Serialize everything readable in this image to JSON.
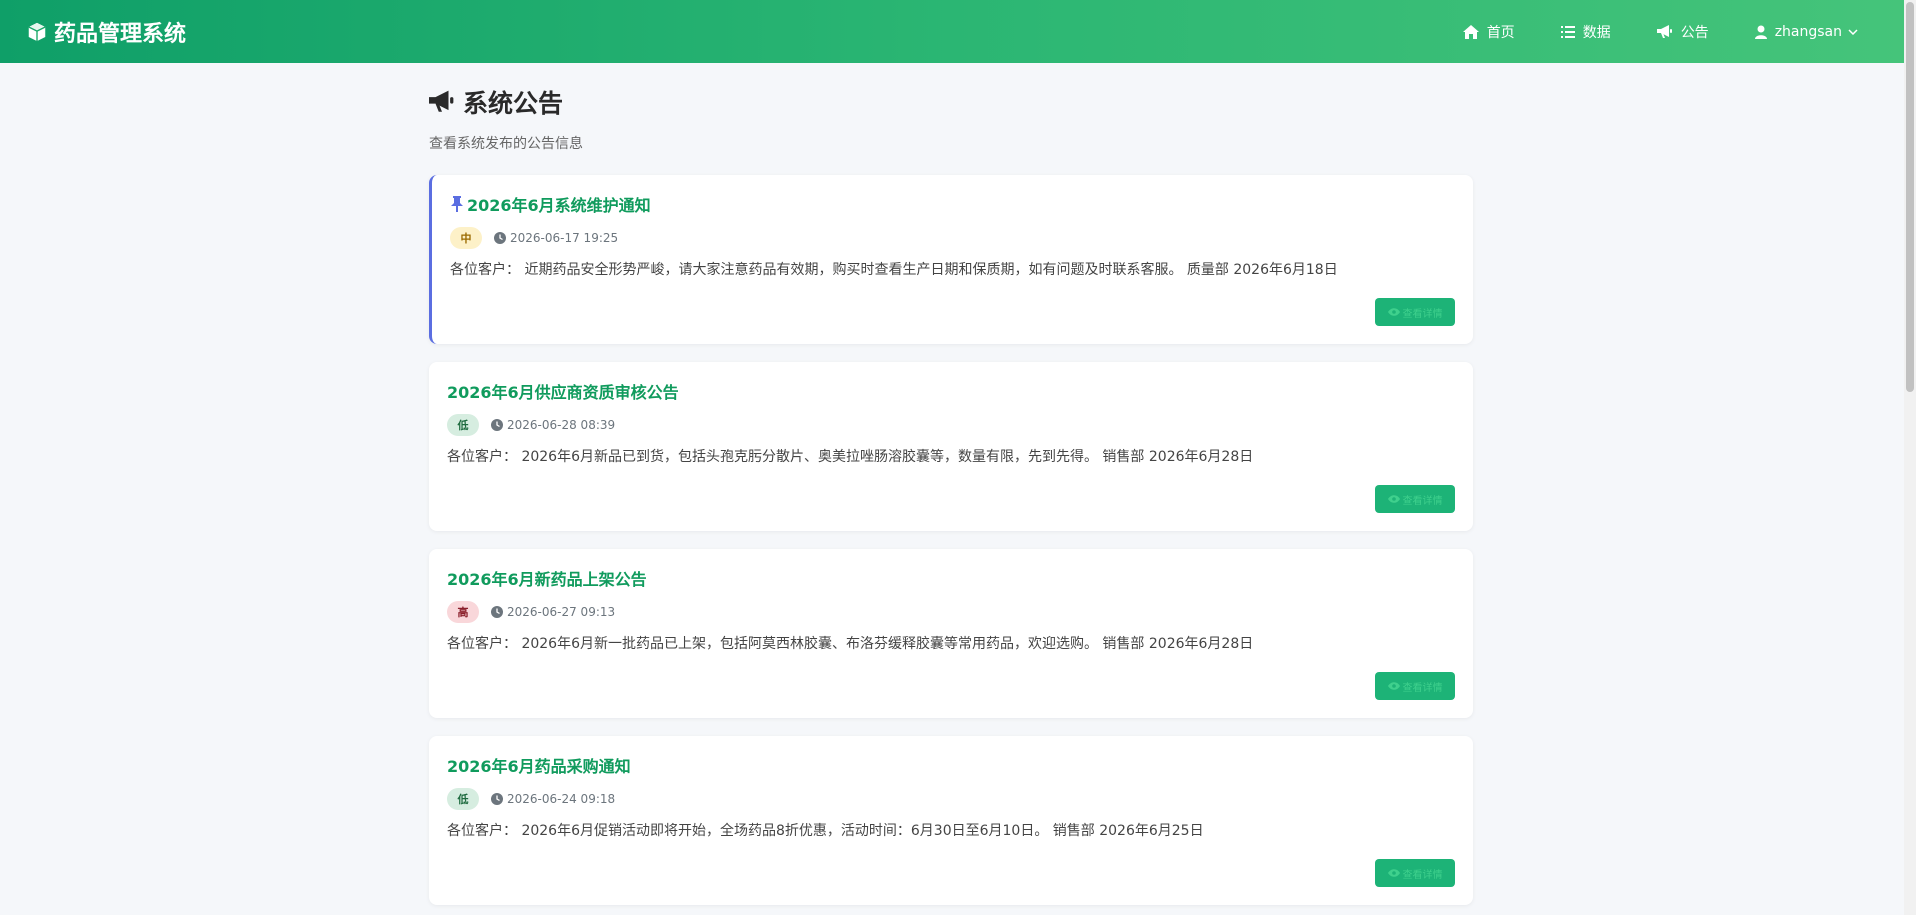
{
  "app": {
    "title": "药品管理系统"
  },
  "nav": {
    "home": "首页",
    "data": "数据",
    "notice": "公告",
    "user": "zhangsan"
  },
  "page": {
    "title": "系统公告",
    "subtitle": "查看系统发布的公告信息"
  },
  "detail_label": "查看详情",
  "notices": [
    {
      "title": "2026年6月系统维护通知",
      "priority": "中",
      "time": "2026-06-17 19:25",
      "content": "各位客户： 近期药品安全形势严峻，请大家注意药品有效期，购买时查看生产日期和保质期，如有问题及时联系客服。 质量部 2026年6月18日"
    },
    {
      "title": "2026年6月供应商资质审核公告",
      "priority": "低",
      "time": "2026-06-28 08:39",
      "content": "各位客户： 2026年6月新品已到货，包括头孢克肟分散片、奥美拉唑肠溶胶囊等，数量有限，先到先得。 销售部 2026年6月28日"
    },
    {
      "title": "2026年6月新药品上架公告",
      "priority": "高",
      "time": "2026-06-27 09:13",
      "content": "各位客户： 2026年6月新一批药品已上架，包括阿莫西林胶囊、布洛芬缓释胶囊等常用药品，欢迎选购。 销售部 2026年6月28日"
    },
    {
      "title": "2026年6月药品采购通知",
      "priority": "低",
      "time": "2026-06-24 09:18",
      "content": "各位客户： 2026年6月促销活动即将开始，全场药品8折优惠，活动时间：6月30日至6月10日。 销售部 2026年6月25日"
    }
  ],
  "colors": {
    "accent": "#109b5d",
    "nav_start": "#0f9f68",
    "nav_end": "#45c47a",
    "pin": "#5b6ee1"
  }
}
